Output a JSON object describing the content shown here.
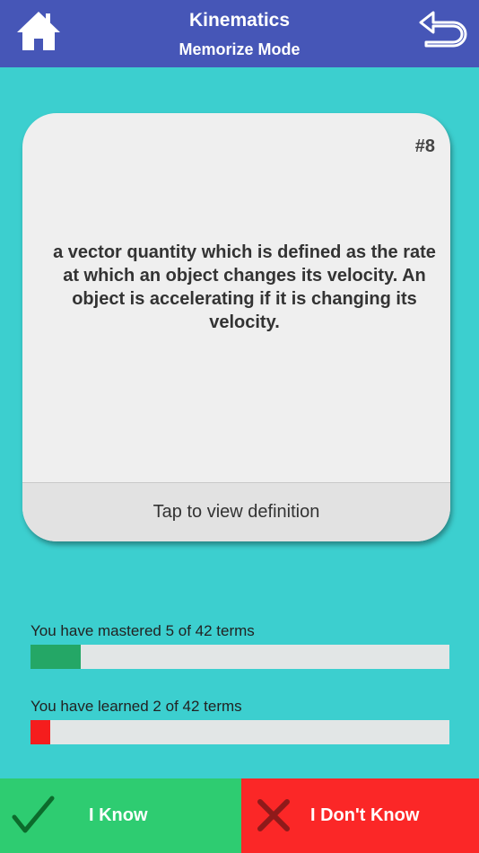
{
  "header": {
    "title": "Kinematics",
    "subtitle": "Memorize Mode",
    "home_icon": "home-icon",
    "back_icon": "undo-arrow-icon"
  },
  "card": {
    "number": "#8",
    "definition": "a vector quantity which is defined as the rate at which an object changes its velocity. An object is accelerating if it is changing its velocity.",
    "footer_label": "Tap to view definition"
  },
  "progress": {
    "mastered": {
      "label": "You have mastered 5 of 42 terms",
      "count": 5,
      "total": 42,
      "color": "#24a766"
    },
    "learned": {
      "label": "You have learned 2 of 42 terms",
      "count": 2,
      "total": 42,
      "color": "#f51d1d"
    }
  },
  "buttons": {
    "know_label": "I Know",
    "know_icon": "checkmark-icon",
    "dont_know_label": "I Don't Know",
    "dont_know_icon": "x-icon"
  },
  "colors": {
    "header_bg": "#4656b7",
    "page_bg": "#3ccfcf",
    "know_bg": "#2ecc71",
    "dont_know_bg": "#fb2727"
  }
}
